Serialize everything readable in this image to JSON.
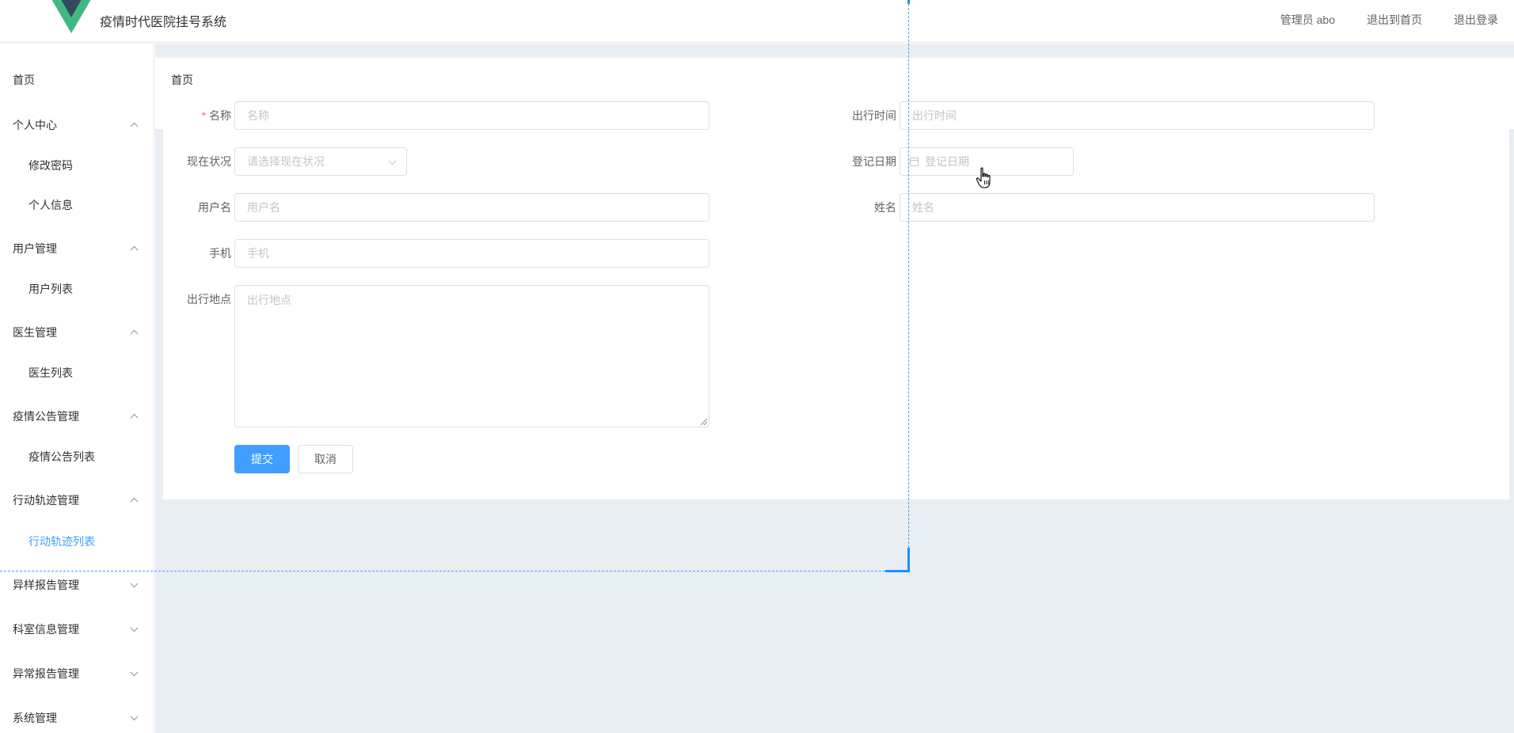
{
  "header": {
    "app_title": "疫情时代医院挂号系统",
    "links": [
      "管理员 abo",
      "退出到首页",
      "退出登录"
    ]
  },
  "sidebar": {
    "home": "首页",
    "groups": [
      {
        "label": "个人中心",
        "expanded": true
      },
      {
        "label": "用户管理",
        "expanded": true
      },
      {
        "label": "医生管理",
        "expanded": true
      },
      {
        "label": "疫情公告管理",
        "expanded": true
      },
      {
        "label": "行动轨迹管理",
        "expanded": true
      },
      {
        "label": "异样报告管理",
        "expanded": false
      },
      {
        "label": "科室信息管理",
        "expanded": false
      },
      {
        "label": "异常报告管理",
        "expanded": false
      },
      {
        "label": "系统管理",
        "expanded": false
      }
    ],
    "sub_items": [
      "修改密码",
      "个人信息",
      "用户列表",
      "医生列表",
      "疫情公告列表",
      "行动轨迹列表"
    ],
    "active_item": "行动轨迹列表"
  },
  "breadcrumb": "首页",
  "form": {
    "name": {
      "label": "名称",
      "required_mark": "*",
      "placeholder": "名称"
    },
    "travel_time": {
      "label": "出行时间",
      "placeholder": "出行时间"
    },
    "status": {
      "label": "现在状况",
      "placeholder": "请选择现在状况"
    },
    "register_date": {
      "label": "登记日期",
      "placeholder": "登记日期"
    },
    "username": {
      "label": "用户名",
      "placeholder": "用户名"
    },
    "real_name": {
      "label": "姓名",
      "placeholder": "姓名"
    },
    "phone": {
      "label": "手机",
      "placeholder": "手机"
    },
    "location": {
      "label": "出行地点",
      "placeholder": "出行地点"
    },
    "submit_label": "提交",
    "cancel_label": "取消"
  },
  "colors": {
    "primary": "#409eff",
    "required": "#f56c6c",
    "main_bg": "#e9eef3",
    "logo_green": "#41b883",
    "logo_dark": "#34495e"
  }
}
